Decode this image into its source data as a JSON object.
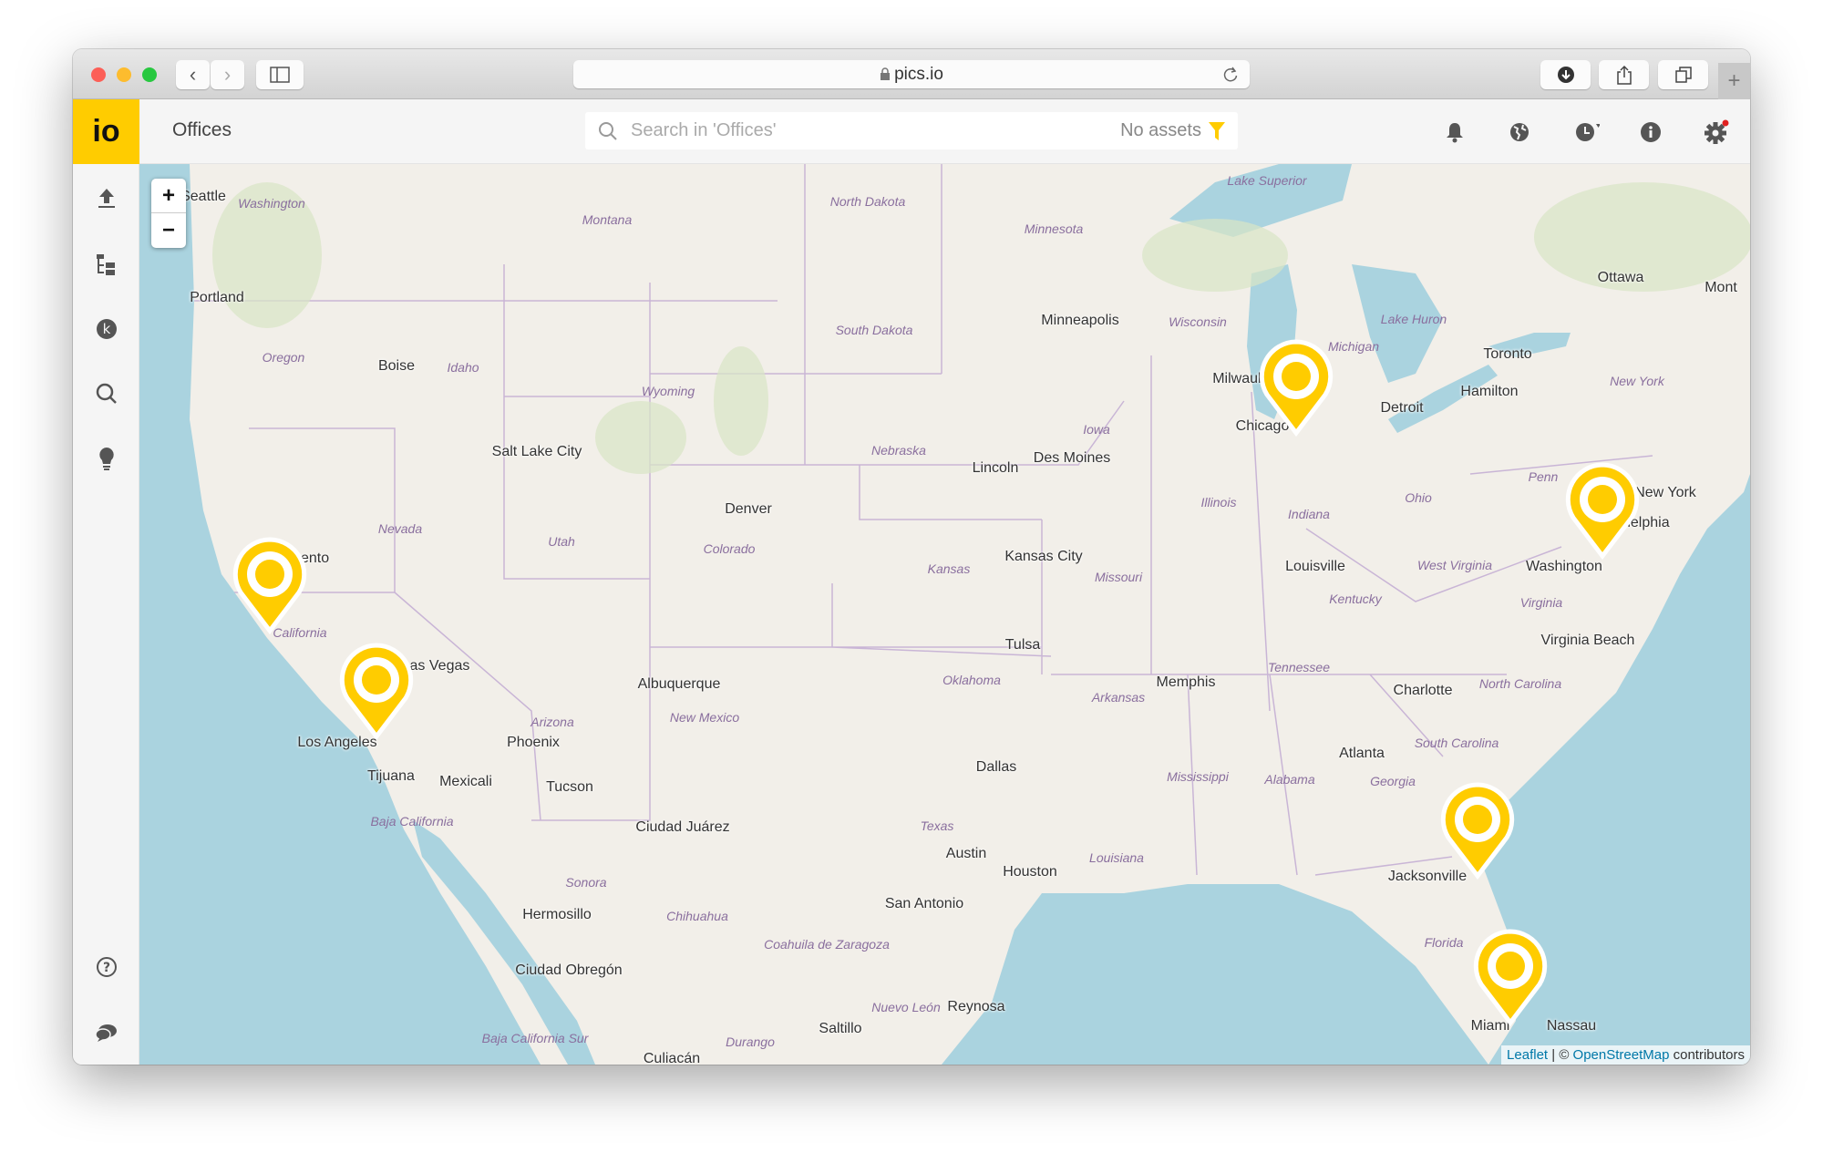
{
  "browser": {
    "url": "pics.io",
    "plus": "+"
  },
  "app": {
    "logo": "io",
    "title": "Offices"
  },
  "search": {
    "placeholder": "Search in 'Offices'",
    "status": "No assets"
  },
  "header_icons": [
    "bell-icon",
    "globe-icon",
    "clock-icon",
    "info-icon",
    "gear-icon"
  ],
  "sidebar_icons": [
    "upload-icon",
    "folder-tree-icon",
    "keywords-icon",
    "search-icon",
    "lightbulb-icon",
    "help-icon",
    "chat-icon"
  ],
  "colors": {
    "brand": "#ffcc00",
    "marker": "#ffcc00",
    "water": "#aad3df",
    "land": "#f2efe9",
    "notification": "#e02020"
  },
  "map": {
    "zoom_in": "+",
    "zoom_out": "−",
    "cities": [
      "Seattle",
      "Portland",
      "Boise",
      "Salt Lake City",
      "Denver",
      "Sacramento",
      "Las Vegas",
      "Los Angeles",
      "Tijuana",
      "Mexicali",
      "Phoenix",
      "Tucson",
      "Albuquerque",
      "Ciudad Juárez",
      "Hermosillo",
      "Ciudad Obregón",
      "Culiacán",
      "Minneapolis",
      "Lincoln",
      "Des Moines",
      "Kansas City",
      "Tulsa",
      "Dallas",
      "Austin",
      "Houston",
      "San Antonio",
      "Memphis",
      "Milwaukee",
      "Chicago",
      "Detroit",
      "Louisville",
      "Atlanta",
      "Charlotte",
      "Jacksonville",
      "Miami",
      "Nassau",
      "Washington",
      "Philadelphia",
      "New York",
      "Virginia Beach",
      "Toronto",
      "Hamilton",
      "Ottawa",
      "Mont",
      "Reynosa",
      "Saltillo"
    ],
    "regions": [
      "Washington",
      "Montana",
      "North Dakota",
      "Minnesota",
      "Oregon",
      "Idaho",
      "Wyoming",
      "South Dakota",
      "Wisconsin",
      "Michigan",
      "Nevada",
      "Utah",
      "Colorado",
      "Nebraska",
      "Iowa",
      "Illinois",
      "Indiana",
      "Ohio",
      "Kansas",
      "Missouri",
      "Kentucky",
      "West Virginia",
      "Virginia",
      "California",
      "Arizona",
      "New Mexico",
      "Oklahoma",
      "Arkansas",
      "Tennessee",
      "North Carolina",
      "South Carolina",
      "Mississippi",
      "Alabama",
      "Georgia",
      "Texas",
      "Louisiana",
      "Florida",
      "Baja California",
      "Sonora",
      "Chihuahua",
      "Coahuila de Zaragoza",
      "Nuevo León",
      "Durango",
      "Baja California Sur",
      "Lake Superior",
      "Lake Huron",
      "New York",
      "Penn"
    ],
    "attribution": {
      "leaflet": "Leaflet",
      "sep": " | © ",
      "osm": "OpenStreetMap",
      "rest": " contributors"
    }
  }
}
